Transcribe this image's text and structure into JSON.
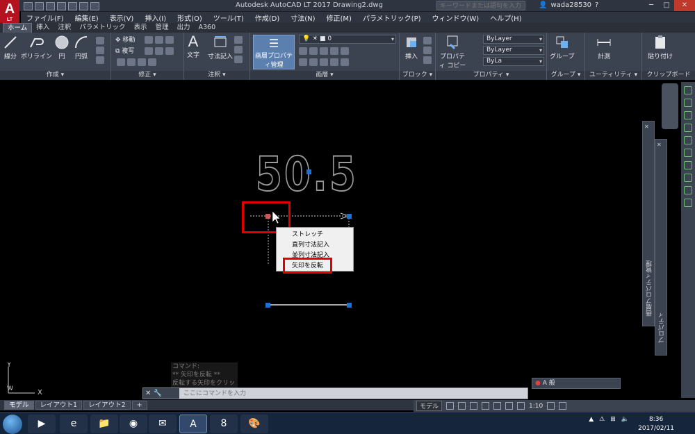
{
  "app": {
    "logo_letter": "A",
    "logo_sub": "LT",
    "title": "Autodesk AutoCAD LT 2017    Drawing2.dwg",
    "search_placeholder": "キーワードまたは語句を入力",
    "user": "wada28530"
  },
  "menu": [
    "ファイル(F)",
    "編集(E)",
    "表示(V)",
    "挿入(I)",
    "形式(O)",
    "ツール(T)",
    "作成(D)",
    "寸法(N)",
    "修正(M)",
    "パラメトリック(P)",
    "ウィンドウ(W)",
    "ヘルプ(H)"
  ],
  "ribbon_tabs": [
    "ホーム",
    "挿入",
    "注釈",
    "パラメトリック",
    "表示",
    "管理",
    "出力",
    "A360"
  ],
  "ribbon": {
    "draw_tools": [
      "線分",
      "ポリライン",
      "円",
      "円弧"
    ],
    "draw_title": "作成 ▾",
    "modify_items": [
      "移動",
      "複写"
    ],
    "modify_title": "修正 ▾",
    "annot_tools": [
      "文字",
      "寸法記入"
    ],
    "annot_title": "注釈 ▾",
    "layer_button": "画層プロパティ管理",
    "layer_value": "0",
    "layer_title": "画層 ▾",
    "block_tool": "挿入",
    "block_title": "ブロック ▾",
    "prop_copy": "プロパティ コピー",
    "prop_values": [
      "ByLayer",
      "ByLayer",
      "ByLa"
    ],
    "prop_title": "プロパティ ▾",
    "group_tool": "グループ",
    "group_title": "グループ ▾",
    "util_tool": "計測",
    "util_title": "ユーティリティ ▾",
    "clip_tool": "貼り付け",
    "clip_title": "クリップボード"
  },
  "drawing": {
    "dimension_text": "50.5"
  },
  "context_menu": [
    "ストレッチ",
    "直列寸法記入",
    "並列寸法記入",
    "矢印を反転"
  ],
  "palettes": {
    "layer_props": "画層プロパティ管理",
    "properties": "プロパティ"
  },
  "command": {
    "history": [
      "コマンド:",
      "** 矢印を反転 **",
      "反転する矢印をクリック:"
    ],
    "placeholder": "ここにコマンドを入力"
  },
  "annot_scale": "A 般",
  "layout_tabs": [
    "モデル",
    "レイアウト1",
    "レイアウト2",
    "+"
  ],
  "status": {
    "model": "モデル",
    "scale": "1:10"
  },
  "clock": {
    "time": "8:36",
    "date": "2017/02/11"
  },
  "ucs": {
    "y": "Y",
    "x": "X",
    "w": "W"
  }
}
